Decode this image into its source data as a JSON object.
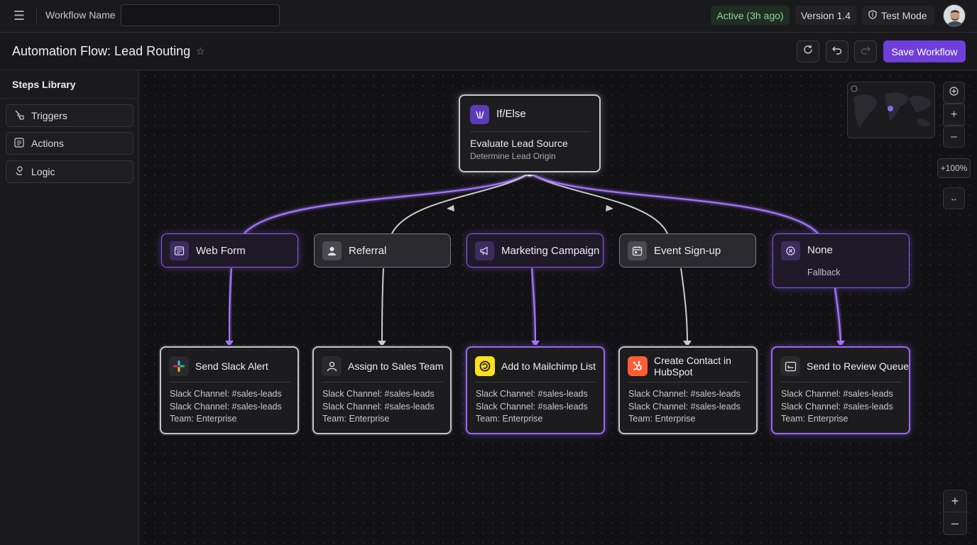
{
  "topbar": {
    "workflow_name_label": "Workflow Name",
    "workflow_name_value": "",
    "status": "Active (3h ago)",
    "version": "Version 1.4",
    "test_mode": "Test Mode"
  },
  "header": {
    "title": "Automation Flow: Lead Routing",
    "save_label": "Save Workflow"
  },
  "sidebar": {
    "title": "Steps Library",
    "items": [
      {
        "label": "Triggers",
        "icon": "triggers-icon"
      },
      {
        "label": "Actions",
        "icon": "actions-icon"
      },
      {
        "label": "Logic",
        "icon": "logic-icon"
      }
    ]
  },
  "canvas": {
    "decision": {
      "type_label": "If/Else",
      "title": "Evaluate Lead Source",
      "subtitle": "Determine Lead Origin"
    },
    "routes": [
      {
        "label": "Web Form",
        "style": "purple",
        "icon": "form-icon"
      },
      {
        "label": "Referral",
        "style": "gray",
        "icon": "user-icon"
      },
      {
        "label": "Marketing Campaign",
        "style": "purple",
        "icon": "megaphone-icon"
      },
      {
        "label": "Event Sign-up",
        "style": "gray",
        "icon": "calendar-icon"
      },
      {
        "label": "None",
        "sublabel": "Fallback",
        "style": "purple",
        "icon": "cancel-circle-icon"
      }
    ],
    "actions": [
      {
        "title": "Send Slack Alert",
        "style": "gray",
        "icon": "slack-icon",
        "lines": [
          "Slack Channel: #sales-leads",
          "Slack Channel: #sales-leads",
          "Team: Enterprise"
        ]
      },
      {
        "title": "Assign to Sales Team",
        "style": "gray",
        "icon": "assign-user-icon",
        "lines": [
          "Slack Channel: #sales-leads",
          "Slack Channel: #sales-leads",
          "Team: Enterprise"
        ]
      },
      {
        "title": "Add to Mailchimp List",
        "style": "purple",
        "icon": "mailchimp-icon",
        "lines": [
          "Slack Channel: #sales-leads",
          "Slack Channel: #sales-leads",
          "Team: Enterprise"
        ]
      },
      {
        "title": "Create Contact in HubSpot",
        "style": "gray",
        "icon": "hubspot-icon",
        "lines": [
          "Slack Channel: #sales-leads",
          "Slack Channel: #sales-leads",
          "Team: Enterprise"
        ]
      },
      {
        "title": "Send to Review Queue",
        "style": "purple",
        "icon": "review-queue-icon",
        "lines": [
          "Slack Channel: #sales-leads",
          "Slack Channel: #sales-leads",
          "Team: Enterprise"
        ]
      }
    ],
    "zoom_label": "+100%"
  },
  "colors": {
    "accent": "#6e3fd9",
    "wire_purple": "#a574ff",
    "wire_gray": "#c9c9cf",
    "active_green": "#8ed49a"
  }
}
